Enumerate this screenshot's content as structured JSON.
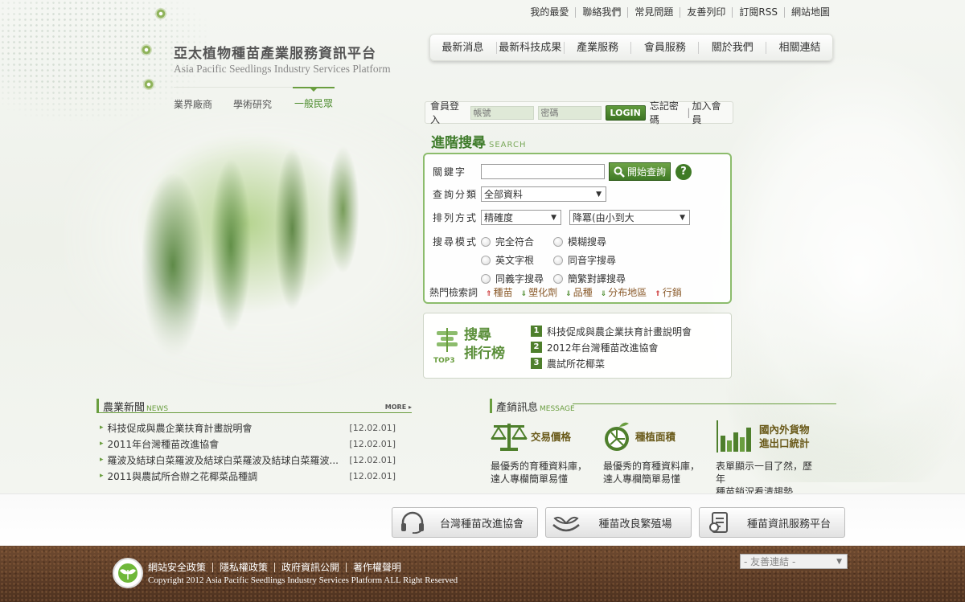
{
  "logo": {
    "title_zh": "亞太植物種苗產業服務資訊平台",
    "title_en": "Asia Pacific Seedlings Industry Services Platform"
  },
  "audience_tabs": [
    {
      "label": "業界廠商"
    },
    {
      "label": "學術研究"
    },
    {
      "label": "一般民眾"
    }
  ],
  "top_links": [
    "我的最愛",
    "聯絡我們",
    "常見問題",
    "友善列印",
    "訂閱RSS",
    "網站地圖"
  ],
  "nav": [
    "最新消息",
    "最新科技成果",
    "產業服務",
    "會員服務",
    "關於我們",
    "相關連結"
  ],
  "login": {
    "label": "會員登入",
    "account_placeholder": "帳號",
    "password_placeholder": "密碼",
    "button": "LOGIN",
    "forgot": "忘記密碼",
    "sep": "|",
    "join": "加入會員"
  },
  "search": {
    "title": "進階搜尋",
    "title_en": "SEARCH",
    "keyword_label": "關鍵字",
    "search_button": "開始查詢",
    "help": "?",
    "category_label": "查詢分類",
    "category_value": "全部資料",
    "sort_label": "排列方式",
    "sort_value": "精確度",
    "order_value": "降冪(由小到大",
    "mode_label": "搜尋模式",
    "modes": [
      "完全符合",
      "模糊搜尋",
      "英文字根",
      "同音字搜尋",
      "同義字搜尋",
      "簡繁對譯搜尋"
    ],
    "hot_label": "熱門檢索詞",
    "hot_terms": [
      {
        "term": "種苗",
        "trend": "up"
      },
      {
        "term": "塑化劑",
        "trend": "down"
      },
      {
        "term": "品種",
        "trend": "down"
      },
      {
        "term": "分布地區",
        "trend": "down"
      },
      {
        "term": "行銷",
        "trend": "up"
      }
    ]
  },
  "top3": {
    "badge": "TOP3",
    "title_line1": "搜尋",
    "title_line2": "排行榜",
    "items": [
      {
        "rank": "1",
        "text": "科技促成與農企業扶育計畫說明會"
      },
      {
        "rank": "2",
        "text": "2012年台灣種苗改進協會"
      },
      {
        "rank": "3",
        "text": "農試所花椰菜"
      }
    ]
  },
  "news": {
    "title": "農業新聞",
    "title_en": "NEWS",
    "more": "MORE",
    "items": [
      {
        "title": "科技促成與農企業扶育計畫說明會",
        "date": "[12.02.01]"
      },
      {
        "title": "2011年台灣種苗改進協會",
        "date": "[12.02.01]"
      },
      {
        "title": "羅波及結球白菜羅波及結球白菜羅波及結球白菜羅波...",
        "date": "[12.02.01]"
      },
      {
        "title": "2011與農試所合辦之花椰菜品種調",
        "date": "[12.02.01]"
      }
    ]
  },
  "marketing": {
    "title": "產銷訊息",
    "title_en": "MESSAGE",
    "items": [
      {
        "name": "交易價格",
        "desc1": "最優秀的育種資料庫，",
        "desc2": "達人專欄簡單易懂"
      },
      {
        "name": "種植面積",
        "desc1": "最優秀的育種資料庫，",
        "desc2": "達人專欄簡單易懂"
      },
      {
        "name": "國內外貨物",
        "name2": "進出口統計",
        "desc1": "表單顯示一目了然，歷年",
        "desc2": "種苗銷況看清趨勢"
      }
    ]
  },
  "partners": [
    "台灣種苗改進協會",
    "種苗改良繁殖場",
    "種苗資訊服務平台"
  ],
  "footer": {
    "links": [
      "網站安全政策",
      "隱私權政策",
      "政府資訊公開",
      "著作權聲明"
    ],
    "copyright": "Copyright 2012 Asia Pacific Seedlings Industry Services Platform ALL Right Reserved",
    "friend_select": "- 友善連結 -"
  },
  "colors": {
    "accent": "#6a9e3f",
    "accent_dark": "#3e7b2a",
    "footer_soil": "#5a3a24"
  }
}
